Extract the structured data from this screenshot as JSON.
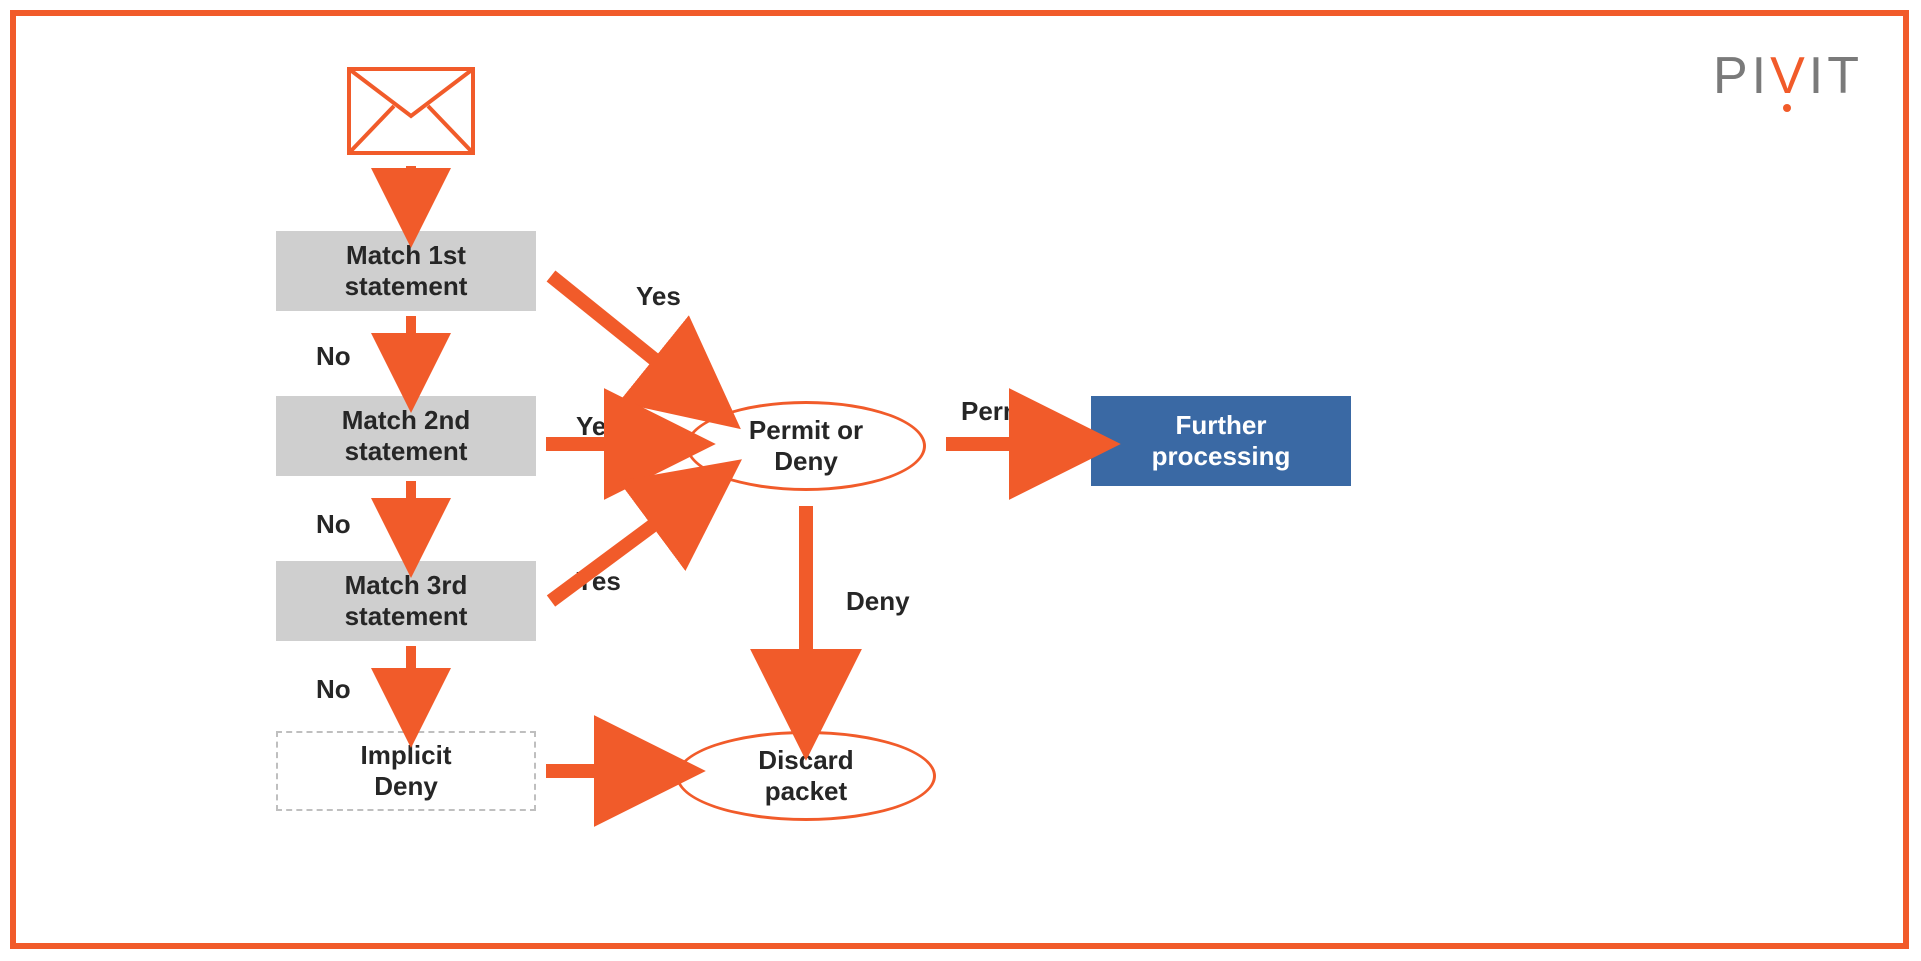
{
  "logo": {
    "text": "PIVIT"
  },
  "nodes": {
    "match1": "Match 1st\nstatement",
    "match2": "Match 2nd\nstatement",
    "match3": "Match 3rd\nstatement",
    "implicit_deny": "Implicit\nDeny",
    "permit_or_deny": "Permit or\nDeny",
    "discard": "Discard\npacket",
    "further": "Further\nprocessing"
  },
  "labels": {
    "no": "No",
    "yes": "Yes",
    "permit": "Permit",
    "deny": "Deny"
  },
  "colors": {
    "accent": "#f15b2a",
    "grey_box": "#cfcfcf",
    "blue_box": "#3a69a4",
    "dark_text": "#262626",
    "logo_grey": "#7a7a7a"
  }
}
